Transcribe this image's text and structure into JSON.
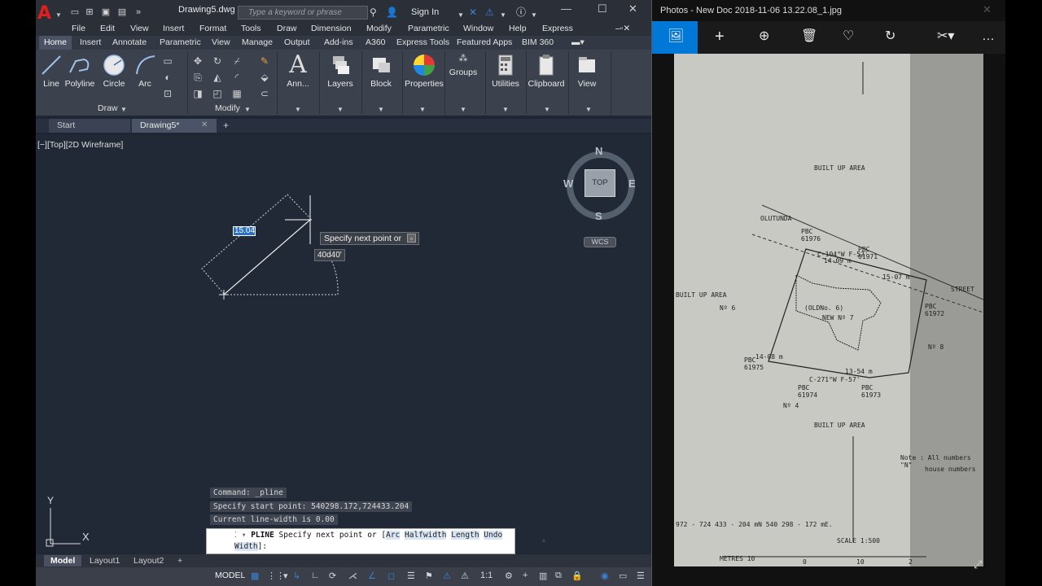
{
  "acad": {
    "doc_title": "Drawing5.dwg",
    "search_placeholder": "Type a keyword or phrase",
    "sign_in": "Sign In",
    "menu": [
      "File",
      "Edit",
      "View",
      "Insert",
      "Format",
      "Tools",
      "Draw",
      "Dimension",
      "Modify",
      "Parametric",
      "Window",
      "Help",
      "Express"
    ],
    "ribbon_tabs": [
      "Home",
      "Insert",
      "Annotate",
      "Parametric",
      "View",
      "Manage",
      "Output",
      "Add-ins",
      "A360",
      "Express Tools",
      "Featured Apps",
      "BIM 360"
    ],
    "draw_tools": [
      "Line",
      "Polyline",
      "Circle",
      "Arc"
    ],
    "panels": {
      "draw": "Draw",
      "modify": "Modify",
      "annotation": "Ann...",
      "layers": "Layers",
      "block": "Block",
      "properties": "Properties",
      "groups": "Groups",
      "utilities": "Utilities",
      "clipboard": "Clipboard",
      "view": "View"
    },
    "file_tabs": [
      "Start",
      "Drawing5*"
    ],
    "viewport_label": "[−][Top][2D Wireframe]",
    "dim_input": "15.04",
    "tooltip": "Specify next point or",
    "angle": "40d40'",
    "viewcube": {
      "n": "N",
      "s": "S",
      "e": "E",
      "w": "W",
      "top": "TOP",
      "wcs": "WCS"
    },
    "ucs": {
      "x": "X",
      "y": "Y"
    },
    "command_history": [
      "Command: _pline",
      "Specify start point: 540298.172,724433.204",
      "Current line-width is 0.00"
    ],
    "command": {
      "name": "PLINE",
      "prompt": "Specify next point or [",
      "options": [
        "Arc",
        "Halfwidth",
        "Length",
        "Undo",
        "Width"
      ],
      "suffix": "]:"
    },
    "layout_tabs": [
      "Model",
      "Layout1",
      "Layout2"
    ],
    "status_model": "MODEL",
    "status_scale": "1:1"
  },
  "photos": {
    "title": "Photos - New Doc 2018-11-06 13.22.08_1.jpg",
    "toolbar_icons": [
      "image-icon",
      "add-icon",
      "zoom-icon",
      "delete-icon",
      "favorite-icon",
      "rotate-icon",
      "edit-icon",
      "more-icon"
    ],
    "map_text": {
      "built_up_area": "BUILT  UP  AREA",
      "built_up_area_left": "BUILT  UP  AREA",
      "no6": "Nº 6",
      "no4": "Nº 4",
      "no8": "Nº 8",
      "oldno": "(OLDNo. 6)",
      "newno": "NEW Nº 7",
      "oluntunda": "OLUTUNDA",
      "street": "STREET",
      "note": "Note :  All numbers \"N\"",
      "note2": "house numbers",
      "scale": "SCALE 1:500",
      "metres": "METRES  10",
      "coords": "972 - 724 433 - 204 mN  540 298 - 172 mE.",
      "pbc1": "PBC 61976",
      "pbc2": "PBC 61975",
      "pbc3": "PBC 61974",
      "pbc4": "PBC 61973",
      "pbc5": "PBC 61972",
      "pbc6": "PBC 61971",
      "bearing1": "C-104°W F-52'",
      "bearing2": "C-271°W F-57'",
      "dist1": "14-08 m",
      "dist2": "13-54 m",
      "dist3": "14-09 m",
      "dist4": "15-07 m",
      "built_lower": "BUILT  UP  AREA",
      "zero": "0",
      "ten": "10",
      "two": "2"
    }
  },
  "colors": {
    "accent": "#0078d7",
    "autocad_red": "#e02020",
    "viewport_bg": "#212836"
  }
}
